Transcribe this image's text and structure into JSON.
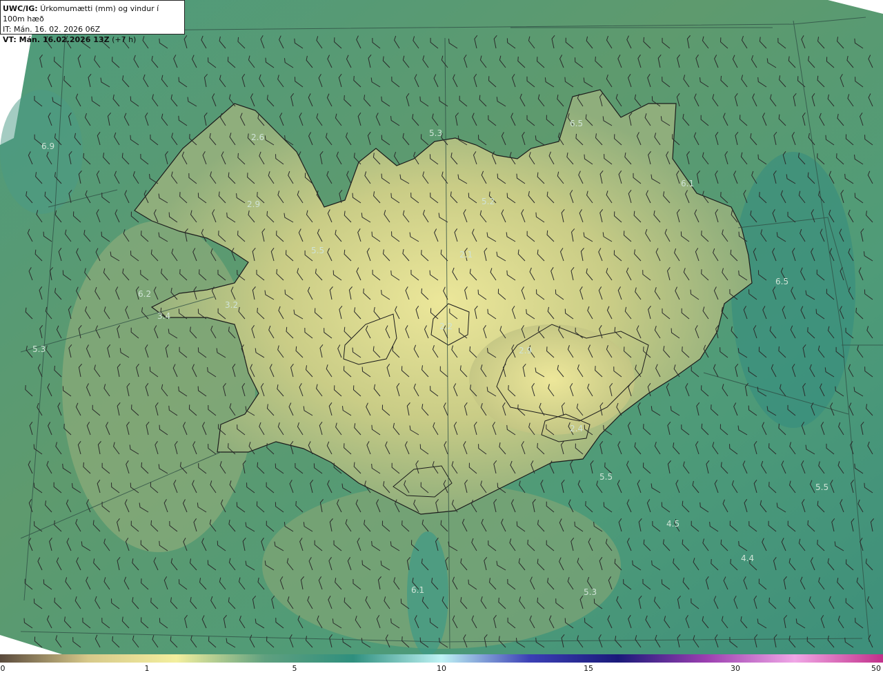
{
  "header": {
    "model": "UWC/IG:",
    "title": "Úrkomumætti (mm) og vindur í 100m hæð",
    "it": "IT: Mán. 16. 02. 2026 06Z",
    "vt_label": "VT: Mán. 16.02.2026 13Z",
    "vt_suffix": "(+7 h)"
  },
  "map_values": [
    "6.9",
    "2.6",
    "2.9",
    "5.3",
    "6.5",
    "6.1",
    "5.2",
    "5.5",
    "2.1",
    "6.2",
    "3.2",
    "3.4",
    "5.3",
    "2.2",
    "2.9",
    "6.5",
    "2.4",
    "5.5",
    "5.5",
    "4.5",
    "4.4",
    "6.1",
    "5.3"
  ],
  "colorbar": {
    "ticks": [
      "0",
      "1",
      "5",
      "10",
      "15",
      "30",
      "50"
    ],
    "colors": [
      "#5a4a3c",
      "#d7c98a",
      "#f3ef9e",
      "#5fa07f",
      "#2f8f7e",
      "#bff3f5",
      "#3b3fb5",
      "#1a1a7a",
      "#9b3fb0",
      "#f0a6e6",
      "#c2308a"
    ]
  }
}
